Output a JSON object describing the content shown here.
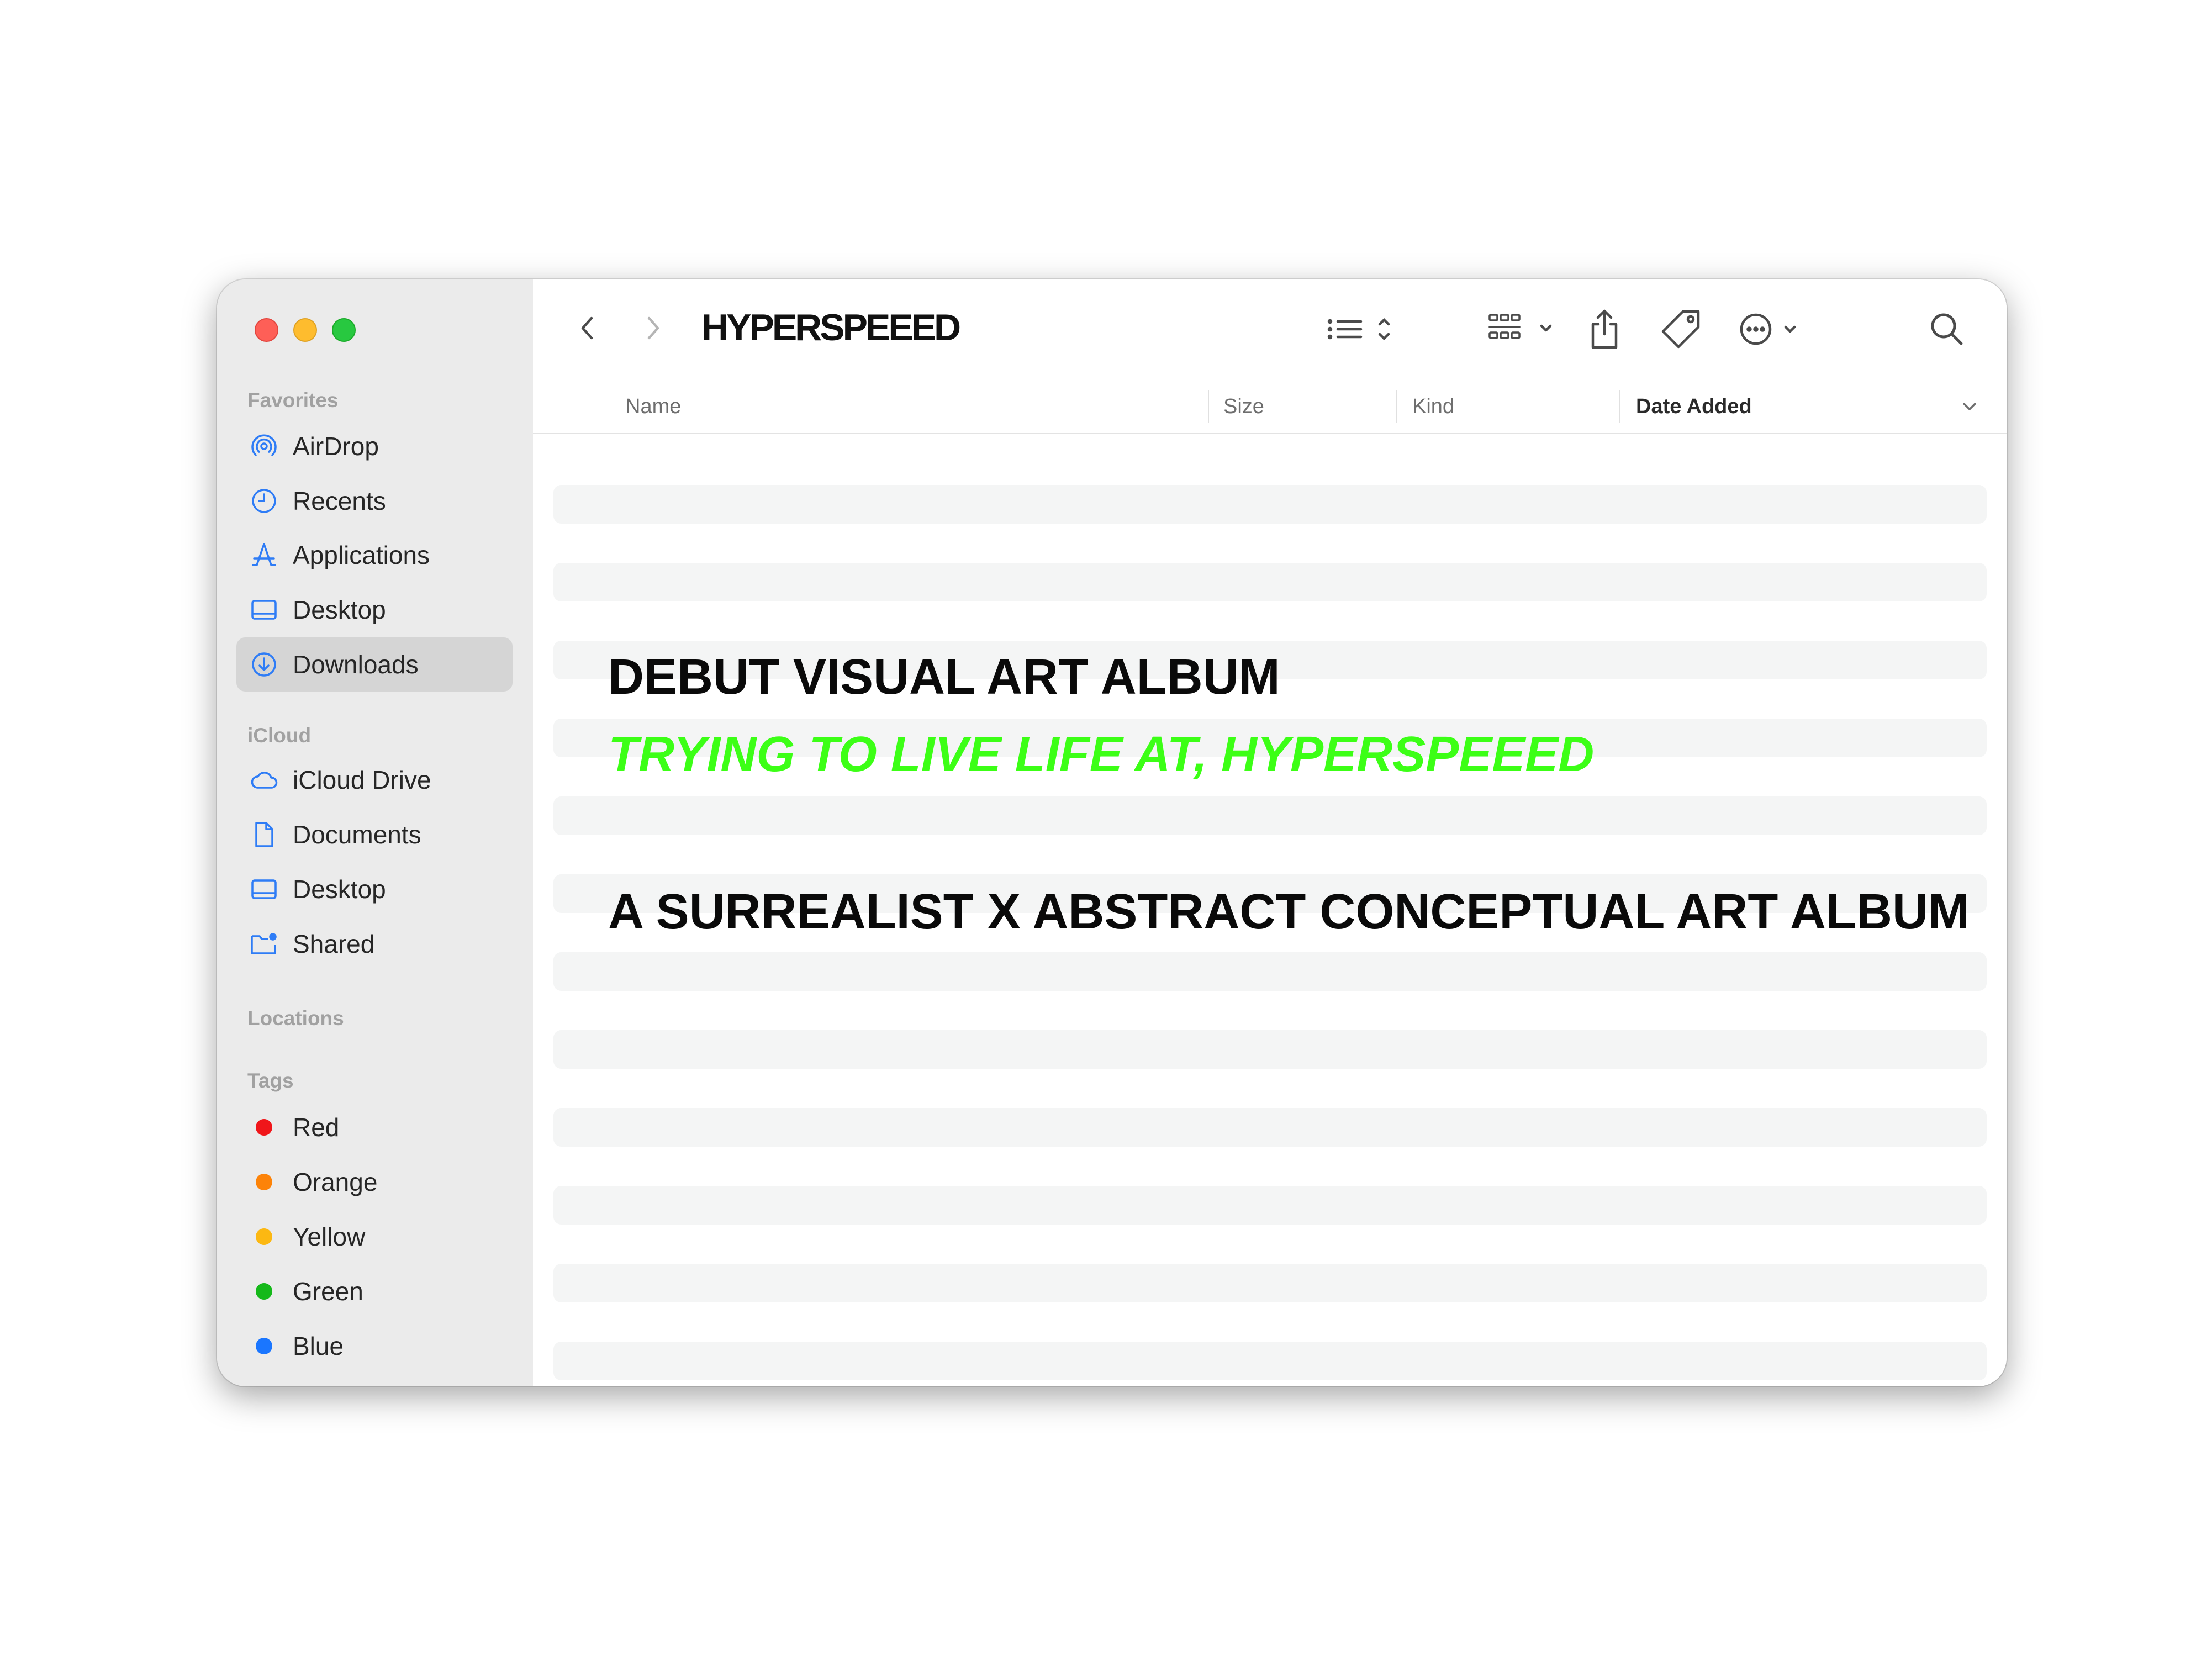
{
  "window": {
    "title": "HYPERSPEEED"
  },
  "sidebar": {
    "sections": [
      {
        "heading": "Favorites",
        "items": [
          {
            "label": "AirDrop",
            "icon": "airdrop-icon"
          },
          {
            "label": "Recents",
            "icon": "clock-icon"
          },
          {
            "label": "Applications",
            "icon": "applications-icon"
          },
          {
            "label": "Desktop",
            "icon": "desktop-icon"
          },
          {
            "label": "Downloads",
            "icon": "download-icon",
            "selected": true
          }
        ]
      },
      {
        "heading": "iCloud",
        "items": [
          {
            "label": "iCloud Drive",
            "icon": "cloud-icon"
          },
          {
            "label": "Documents",
            "icon": "document-icon"
          },
          {
            "label": "Desktop",
            "icon": "desktop-icon"
          },
          {
            "label": "Shared",
            "icon": "shared-folder-icon"
          }
        ]
      },
      {
        "heading": "Locations",
        "items": []
      },
      {
        "heading": "Tags",
        "items": [
          {
            "label": "Red",
            "color": "#f0161a"
          },
          {
            "label": "Orange",
            "color": "#fd8308"
          },
          {
            "label": "Yellow",
            "color": "#fcb812"
          },
          {
            "label": "Green",
            "color": "#15b91a"
          },
          {
            "label": "Blue",
            "color": "#1a76ff"
          }
        ]
      }
    ]
  },
  "columns": {
    "name": "Name",
    "size": "Size",
    "kind": "Kind",
    "date_added": "Date Added",
    "sorted_by": "Date Added"
  },
  "toolbar": {
    "icons": [
      "back-icon",
      "forward-icon",
      "list-view-icon",
      "grid-view-icon",
      "share-icon",
      "tag-icon",
      "more-icon",
      "search-icon"
    ]
  },
  "overlay": {
    "line1": "DEBUT VISUAL ART ALBUM",
    "line2": "TRYING TO LIVE LIFE AT, HYPERSPEEED",
    "line3": "A SURREALIST X ABSTRACT CONCEPTUAL ART ALBUM",
    "accent_color": "#3cff16"
  },
  "file_rows_shown": 12
}
